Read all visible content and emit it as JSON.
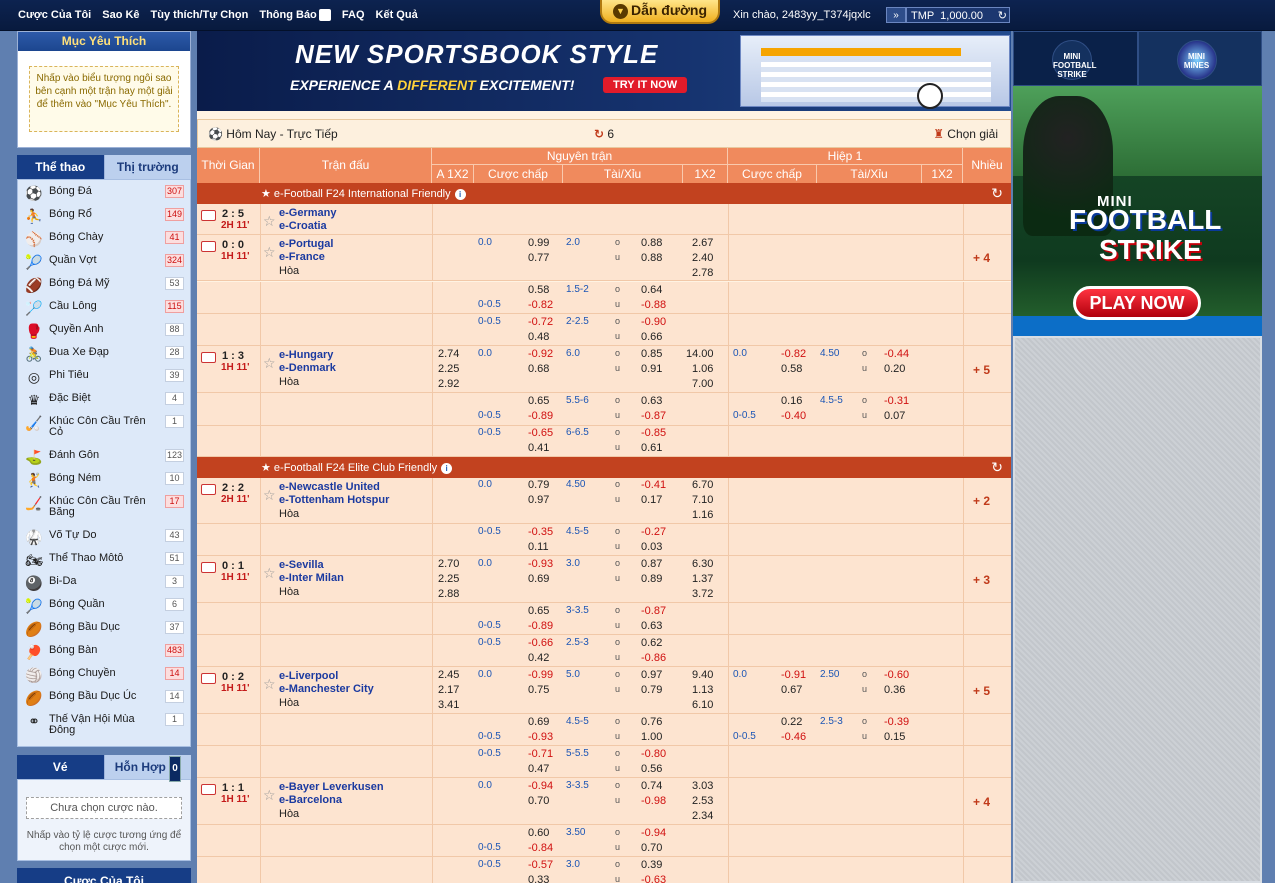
{
  "topnav": {
    "items": [
      "Cược Của Tôi",
      "Sao Kê",
      "Tùy thích/Tự Chọn",
      "Thông Báo",
      "FAQ",
      "Kết Quả"
    ],
    "notif_count": "1",
    "guide": "Dẫn đường",
    "greeting": "Xin chào, 2483yy_T374jqxlc",
    "currency": "TMP",
    "balance": "1,000.00"
  },
  "favorites": {
    "title": "Mục Yêu Thích",
    "hint": "Nhấp vào biểu tượng ngôi sao bên cạnh một trận hay một giải để thêm vào \"Mục Yêu Thích\"."
  },
  "sport_tabs": {
    "sports": "Thể thao",
    "market": "Thị trường"
  },
  "sports": [
    {
      "name": "Bóng Đá",
      "count": "307",
      "icon": "soccer-player-icon",
      "hot": true
    },
    {
      "name": "Bóng Rổ",
      "count": "149",
      "icon": "basketball-player-icon",
      "hot": true
    },
    {
      "name": "Bóng Chày",
      "count": "41",
      "icon": "baseball-glove-icon",
      "hot": true
    },
    {
      "name": "Quần Vợt",
      "count": "324",
      "icon": "tennis-racket-icon",
      "hot": true
    },
    {
      "name": "Bóng Đá Mỹ",
      "count": "53",
      "icon": "american-football-icon",
      "hot": false
    },
    {
      "name": "Cầu Lông",
      "count": "115",
      "icon": "badminton-icon",
      "hot": true
    },
    {
      "name": "Quyền Anh",
      "count": "88",
      "icon": "boxing-glove-icon",
      "hot": false
    },
    {
      "name": "Đua Xe Đạp",
      "count": "28",
      "icon": "cycling-icon",
      "hot": false
    },
    {
      "name": "Phi Tiêu",
      "count": "39",
      "icon": "dartboard-icon",
      "hot": false
    },
    {
      "name": "Đặc Biệt",
      "count": "4",
      "icon": "crown-icon",
      "hot": false
    },
    {
      "name": "Khúc Côn Cầu Trên Cỏ",
      "count": "1",
      "icon": "field-hockey-icon",
      "hot": false,
      "tall": true
    },
    {
      "name": "Đánh Gôn",
      "count": "123",
      "icon": "golf-icon",
      "hot": false
    },
    {
      "name": "Bóng Ném",
      "count": "10",
      "icon": "handball-icon",
      "hot": false
    },
    {
      "name": "Khúc Côn Cầu Trên Băng",
      "count": "17",
      "icon": "ice-hockey-icon",
      "hot": true,
      "tall": true
    },
    {
      "name": "Võ Tự Do",
      "count": "43",
      "icon": "martial-arts-icon",
      "hot": false
    },
    {
      "name": "Thể Thao Môtô",
      "count": "51",
      "icon": "motorsport-icon",
      "hot": false
    },
    {
      "name": "Bi-Da",
      "count": "3",
      "icon": "billiards-icon",
      "hot": false
    },
    {
      "name": "Bóng Quần",
      "count": "6",
      "icon": "squash-icon",
      "hot": false
    },
    {
      "name": "Bóng Bầu Dục",
      "count": "37",
      "icon": "rugby-icon",
      "hot": false
    },
    {
      "name": "Bóng Bàn",
      "count": "483",
      "icon": "table-tennis-icon",
      "hot": true
    },
    {
      "name": "Bóng Chuyền",
      "count": "14",
      "icon": "volleyball-icon",
      "hot": true
    },
    {
      "name": "Bóng Bầu Dục Úc",
      "count": "14",
      "icon": "aussie-rules-icon",
      "hot": false
    },
    {
      "name": "Thế Vận Hội Mùa Đông",
      "count": "1",
      "icon": "olympic-rings-icon",
      "hot": false,
      "tall": true
    }
  ],
  "betslip": {
    "tab_single": "Vé",
    "tab_combo": "Hỗn Hợp",
    "combo_count": "0",
    "empty": "Chưa chọn cược nào.",
    "hint": "Nhấp vào tỷ lệ cược tương ứng để chọn một cược mới.",
    "my_bets": "Cược Của Tôi"
  },
  "banner": {
    "title": "NEW SPORTSBOOK STYLE",
    "sub_pre": "EXPERIENCE A ",
    "sub_em": "DIFFERENT",
    "sub_post": " EXCITEMENT!",
    "cta": "TRY IT NOW"
  },
  "subhead": {
    "title": "Hôm Nay - Trực Tiếp",
    "count": "6",
    "select": "Chọn giải"
  },
  "table_header": {
    "time": "Thời Gian",
    "match": "Trận đấu",
    "full": "Nguyên trận",
    "half": "Hiệp 1",
    "more": "Nhiều",
    "a1x2": "A 1X2",
    "hdp": "Cược chấp",
    "ou": "Tài/Xỉu",
    "x12": "1X2"
  },
  "leagues": [
    "e-Football F24 International Friendly",
    "e-Football F24 Elite Club Friendly"
  ],
  "matches": [
    {
      "score": "2 : 5",
      "time": "2H 11'",
      "home": "e-Germany",
      "away": "e-Croatia",
      "draw": ""
    },
    {
      "score": "0 : 0",
      "time": "1H 11'",
      "home": "e-Portugal",
      "away": "e-France",
      "draw": "Hòa",
      "more": "+ 4"
    },
    {
      "score": "1 : 3",
      "time": "1H 11'",
      "home": "e-Hungary",
      "away": "e-Denmark",
      "draw": "Hòa",
      "more": "+ 5"
    },
    {
      "score": "2 : 2",
      "time": "2H 11'",
      "home": "e-Newcastle United",
      "away": "e-Tottenham Hotspur",
      "draw": "Hòa",
      "more": "+ 2"
    },
    {
      "score": "0 : 1",
      "time": "1H 11'",
      "home": "e-Sevilla",
      "away": "e-Inter Milan",
      "draw": "Hòa",
      "more": "+ 3"
    },
    {
      "score": "0 : 2",
      "time": "1H 11'",
      "home": "e-Liverpool",
      "away": "e-Manchester City",
      "draw": "Hòa",
      "more": "+ 5"
    },
    {
      "score": "1 : 1",
      "time": "1H 11'",
      "home": "e-Bayer Leverkusen",
      "away": "e-Barcelona",
      "draw": "Hòa",
      "more": "+ 4"
    }
  ],
  "odds_cells": [
    [
      "478,243",
      "0.0",
      "hdp"
    ],
    [
      "528,243",
      "0.99",
      "od"
    ],
    [
      "528,258",
      "0.77",
      "od"
    ],
    [
      "566,243",
      "2.0",
      "hdp"
    ],
    [
      "615,243",
      "o",
      "ou"
    ],
    [
      "615,258",
      "u",
      "ou"
    ],
    [
      "641,243",
      "0.88",
      "od"
    ],
    [
      "641,258",
      "0.88",
      "od"
    ],
    [
      "692,243",
      "2.67",
      "od"
    ],
    [
      "692,258",
      "2.40",
      "od"
    ],
    [
      "692,273",
      "2.78",
      "od"
    ],
    [
      "528,290",
      "0.58",
      "od"
    ],
    [
      "478,305",
      "0-0.5",
      "hdp"
    ],
    [
      "528,305",
      "-0.82",
      "neg"
    ],
    [
      "566,290",
      "1.5-2",
      "hdp"
    ],
    [
      "615,290",
      "o",
      "ou"
    ],
    [
      "615,305",
      "u",
      "ou"
    ],
    [
      "641,290",
      "0.64",
      "od"
    ],
    [
      "641,305",
      "-0.88",
      "neg"
    ],
    [
      "478,322",
      "0-0.5",
      "hdp"
    ],
    [
      "528,322",
      "-0.72",
      "neg"
    ],
    [
      "528,337",
      "0.48",
      "od"
    ],
    [
      "566,322",
      "2-2.5",
      "hdp"
    ],
    [
      "615,322",
      "o",
      "ou"
    ],
    [
      "615,337",
      "u",
      "ou"
    ],
    [
      "641,322",
      "-0.90",
      "neg"
    ],
    [
      "641,337",
      "0.66",
      "od"
    ],
    [
      "438,354",
      "2.74",
      "od"
    ],
    [
      "438,369",
      "2.25",
      "od"
    ],
    [
      "438,384",
      "2.92",
      "od"
    ],
    [
      "478,354",
      "0.0",
      "hdp"
    ],
    [
      "528,354",
      "-0.92",
      "neg"
    ],
    [
      "528,369",
      "0.68",
      "od"
    ],
    [
      "566,354",
      "6.0",
      "hdp"
    ],
    [
      "615,354",
      "o",
      "ou"
    ],
    [
      "615,369",
      "u",
      "ou"
    ],
    [
      "641,354",
      "0.85",
      "od"
    ],
    [
      "641,369",
      "0.91",
      "od"
    ],
    [
      "686,354",
      "14.00",
      "od"
    ],
    [
      "692,369",
      "1.06",
      "od"
    ],
    [
      "692,384",
      "7.00",
      "od"
    ],
    [
      "733,354",
      "0.0",
      "hdp"
    ],
    [
      "781,354",
      "-0.82",
      "neg"
    ],
    [
      "781,369",
      "0.58",
      "od"
    ],
    [
      "820,354",
      "4.50",
      "hdp"
    ],
    [
      "862,354",
      "o",
      "ou"
    ],
    [
      "862,369",
      "u",
      "ou"
    ],
    [
      "884,354",
      "-0.44",
      "neg"
    ],
    [
      "884,369",
      "0.20",
      "od"
    ],
    [
      "528,401",
      "0.65",
      "od"
    ],
    [
      "478,416",
      "0-0.5",
      "hdp"
    ],
    [
      "528,416",
      "-0.89",
      "neg"
    ],
    [
      "566,401",
      "5.5-6",
      "hdp"
    ],
    [
      "615,401",
      "o",
      "ou"
    ],
    [
      "615,416",
      "u",
      "ou"
    ],
    [
      "641,401",
      "0.63",
      "od"
    ],
    [
      "641,416",
      "-0.87",
      "neg"
    ],
    [
      "781,401",
      "0.16",
      "od"
    ],
    [
      "733,416",
      "0-0.5",
      "hdp"
    ],
    [
      "781,416",
      "-0.40",
      "neg"
    ],
    [
      "820,401",
      "4.5-5",
      "hdp"
    ],
    [
      "862,401",
      "o",
      "ou"
    ],
    [
      "862,416",
      "u",
      "ou"
    ],
    [
      "884,401",
      "-0.31",
      "neg"
    ],
    [
      "884,416",
      "0.07",
      "od"
    ],
    [
      "478,433",
      "0-0.5",
      "hdp"
    ],
    [
      "528,433",
      "-0.65",
      "neg"
    ],
    [
      "528,448",
      "0.41",
      "od"
    ],
    [
      "566,433",
      "6-6.5",
      "hdp"
    ],
    [
      "615,433",
      "o",
      "ou"
    ],
    [
      "615,448",
      "u",
      "ou"
    ],
    [
      "641,433",
      "-0.85",
      "neg"
    ],
    [
      "641,448",
      "0.61",
      "od"
    ],
    [
      "478,485",
      "0.0",
      "hdp"
    ],
    [
      "528,485",
      "0.79",
      "od"
    ],
    [
      "528,500",
      "0.97",
      "od"
    ],
    [
      "566,485",
      "4.50",
      "hdp"
    ],
    [
      "615,485",
      "o",
      "ou"
    ],
    [
      "615,500",
      "u",
      "ou"
    ],
    [
      "641,485",
      "-0.41",
      "neg"
    ],
    [
      "641,500",
      "0.17",
      "od"
    ],
    [
      "692,485",
      "6.70",
      "od"
    ],
    [
      "692,500",
      "7.10",
      "od"
    ],
    [
      "692,515",
      "1.16",
      "od"
    ],
    [
      "478,532",
      "0-0.5",
      "hdp"
    ],
    [
      "528,532",
      "-0.35",
      "neg"
    ],
    [
      "528,547",
      "0.11",
      "od"
    ],
    [
      "566,532",
      "4.5-5",
      "hdp"
    ],
    [
      "615,532",
      "o",
      "ou"
    ],
    [
      "615,547",
      "u",
      "ou"
    ],
    [
      "641,532",
      "-0.27",
      "neg"
    ],
    [
      "641,547",
      "0.03",
      "od"
    ],
    [
      "438,564",
      "2.70",
      "od"
    ],
    [
      "438,579",
      "2.25",
      "od"
    ],
    [
      "438,594",
      "2.88",
      "od"
    ],
    [
      "478,564",
      "0.0",
      "hdp"
    ],
    [
      "528,564",
      "-0.93",
      "neg"
    ],
    [
      "528,579",
      "0.69",
      "od"
    ],
    [
      "566,564",
      "3.0",
      "hdp"
    ],
    [
      "615,564",
      "o",
      "ou"
    ],
    [
      "615,579",
      "u",
      "ou"
    ],
    [
      "641,564",
      "0.87",
      "od"
    ],
    [
      "641,579",
      "0.89",
      "od"
    ],
    [
      "692,564",
      "6.30",
      "od"
    ],
    [
      "692,579",
      "1.37",
      "od"
    ],
    [
      "692,594",
      "3.72",
      "od"
    ],
    [
      "528,611",
      "0.65",
      "od"
    ],
    [
      "478,626",
      "0-0.5",
      "hdp"
    ],
    [
      "528,626",
      "-0.89",
      "neg"
    ],
    [
      "566,611",
      "3-3.5",
      "hdp"
    ],
    [
      "615,611",
      "o",
      "ou"
    ],
    [
      "615,626",
      "u",
      "ou"
    ],
    [
      "641,611",
      "-0.87",
      "neg"
    ],
    [
      "641,626",
      "0.63",
      "od"
    ],
    [
      "478,643",
      "0-0.5",
      "hdp"
    ],
    [
      "528,643",
      "-0.66",
      "neg"
    ],
    [
      "528,658",
      "0.42",
      "od"
    ],
    [
      "566,643",
      "2.5-3",
      "hdp"
    ],
    [
      "615,643",
      "o",
      "ou"
    ],
    [
      "615,658",
      "u",
      "ou"
    ],
    [
      "641,643",
      "0.62",
      "od"
    ],
    [
      "641,658",
      "-0.86",
      "neg"
    ],
    [
      "438,675",
      "2.45",
      "od"
    ],
    [
      "438,690",
      "2.17",
      "od"
    ],
    [
      "438,705",
      "3.41",
      "od"
    ],
    [
      "478,675",
      "0.0",
      "hdp"
    ],
    [
      "528,675",
      "-0.99",
      "neg"
    ],
    [
      "528,690",
      "0.75",
      "od"
    ],
    [
      "566,675",
      "5.0",
      "hdp"
    ],
    [
      "615,675",
      "o",
      "ou"
    ],
    [
      "615,690",
      "u",
      "ou"
    ],
    [
      "641,675",
      "0.97",
      "od"
    ],
    [
      "641,690",
      "0.79",
      "od"
    ],
    [
      "692,675",
      "9.40",
      "od"
    ],
    [
      "692,690",
      "1.13",
      "od"
    ],
    [
      "692,705",
      "6.10",
      "od"
    ],
    [
      "733,675",
      "0.0",
      "hdp"
    ],
    [
      "781,675",
      "-0.91",
      "neg"
    ],
    [
      "781,690",
      "0.67",
      "od"
    ],
    [
      "820,675",
      "2.50",
      "hdp"
    ],
    [
      "862,675",
      "o",
      "ou"
    ],
    [
      "862,690",
      "u",
      "ou"
    ],
    [
      "884,675",
      "-0.60",
      "neg"
    ],
    [
      "884,690",
      "0.36",
      "od"
    ],
    [
      "528,722",
      "0.69",
      "od"
    ],
    [
      "478,737",
      "0-0.5",
      "hdp"
    ],
    [
      "528,737",
      "-0.93",
      "neg"
    ],
    [
      "566,722",
      "4.5-5",
      "hdp"
    ],
    [
      "615,722",
      "o",
      "ou"
    ],
    [
      "615,737",
      "u",
      "ou"
    ],
    [
      "641,722",
      "0.76",
      "od"
    ],
    [
      "641,737",
      "1.00",
      "od"
    ],
    [
      "781,722",
      "0.22",
      "od"
    ],
    [
      "733,737",
      "0-0.5",
      "hdp"
    ],
    [
      "781,737",
      "-0.46",
      "neg"
    ],
    [
      "820,722",
      "2.5-3",
      "hdp"
    ],
    [
      "862,722",
      "o",
      "ou"
    ],
    [
      "862,737",
      "u",
      "ou"
    ],
    [
      "884,722",
      "-0.39",
      "neg"
    ],
    [
      "884,737",
      "0.15",
      "od"
    ],
    [
      "478,754",
      "0-0.5",
      "hdp"
    ],
    [
      "528,754",
      "-0.71",
      "neg"
    ],
    [
      "528,769",
      "0.47",
      "od"
    ],
    [
      "566,754",
      "5-5.5",
      "hdp"
    ],
    [
      "615,754",
      "o",
      "ou"
    ],
    [
      "615,769",
      "u",
      "ou"
    ],
    [
      "641,754",
      "-0.80",
      "neg"
    ],
    [
      "641,769",
      "0.56",
      "od"
    ],
    [
      "478,786",
      "0.0",
      "hdp"
    ],
    [
      "528,786",
      "-0.94",
      "neg"
    ],
    [
      "528,801",
      "0.70",
      "od"
    ],
    [
      "566,786",
      "3-3.5",
      "hdp"
    ],
    [
      "615,786",
      "o",
      "ou"
    ],
    [
      "615,801",
      "u",
      "ou"
    ],
    [
      "641,786",
      "0.74",
      "od"
    ],
    [
      "641,801",
      "-0.98",
      "neg"
    ],
    [
      "692,786",
      "3.03",
      "od"
    ],
    [
      "692,801",
      "2.53",
      "od"
    ],
    [
      "692,816",
      "2.34",
      "od"
    ],
    [
      "528,833",
      "0.60",
      "od"
    ],
    [
      "478,848",
      "0-0.5",
      "hdp"
    ],
    [
      "528,848",
      "-0.84",
      "neg"
    ],
    [
      "566,833",
      "3.50",
      "hdp"
    ],
    [
      "615,833",
      "o",
      "ou"
    ],
    [
      "615,848",
      "u",
      "ou"
    ],
    [
      "641,833",
      "-0.94",
      "neg"
    ],
    [
      "641,848",
      "0.70",
      "od"
    ],
    [
      "478,865",
      "0-0.5",
      "hdp"
    ],
    [
      "528,865",
      "-0.57",
      "neg"
    ],
    [
      "528,880",
      "0.33",
      "od"
    ],
    [
      "566,865",
      "3.0",
      "hdp"
    ],
    [
      "615,865",
      "o",
      "ou"
    ],
    [
      "615,880",
      "u",
      "ou"
    ],
    [
      "641,865",
      "0.39",
      "od"
    ],
    [
      "641,880",
      "-0.63",
      "neg"
    ]
  ],
  "right": {
    "game1": "MINI FOOTBALL STRIKE",
    "game2": "MINI MINES",
    "promo_mini": "MINI",
    "promo_title1": "FOOTBALL",
    "promo_title2": "STRIKE",
    "promo_cta": "PLAY NOW"
  }
}
